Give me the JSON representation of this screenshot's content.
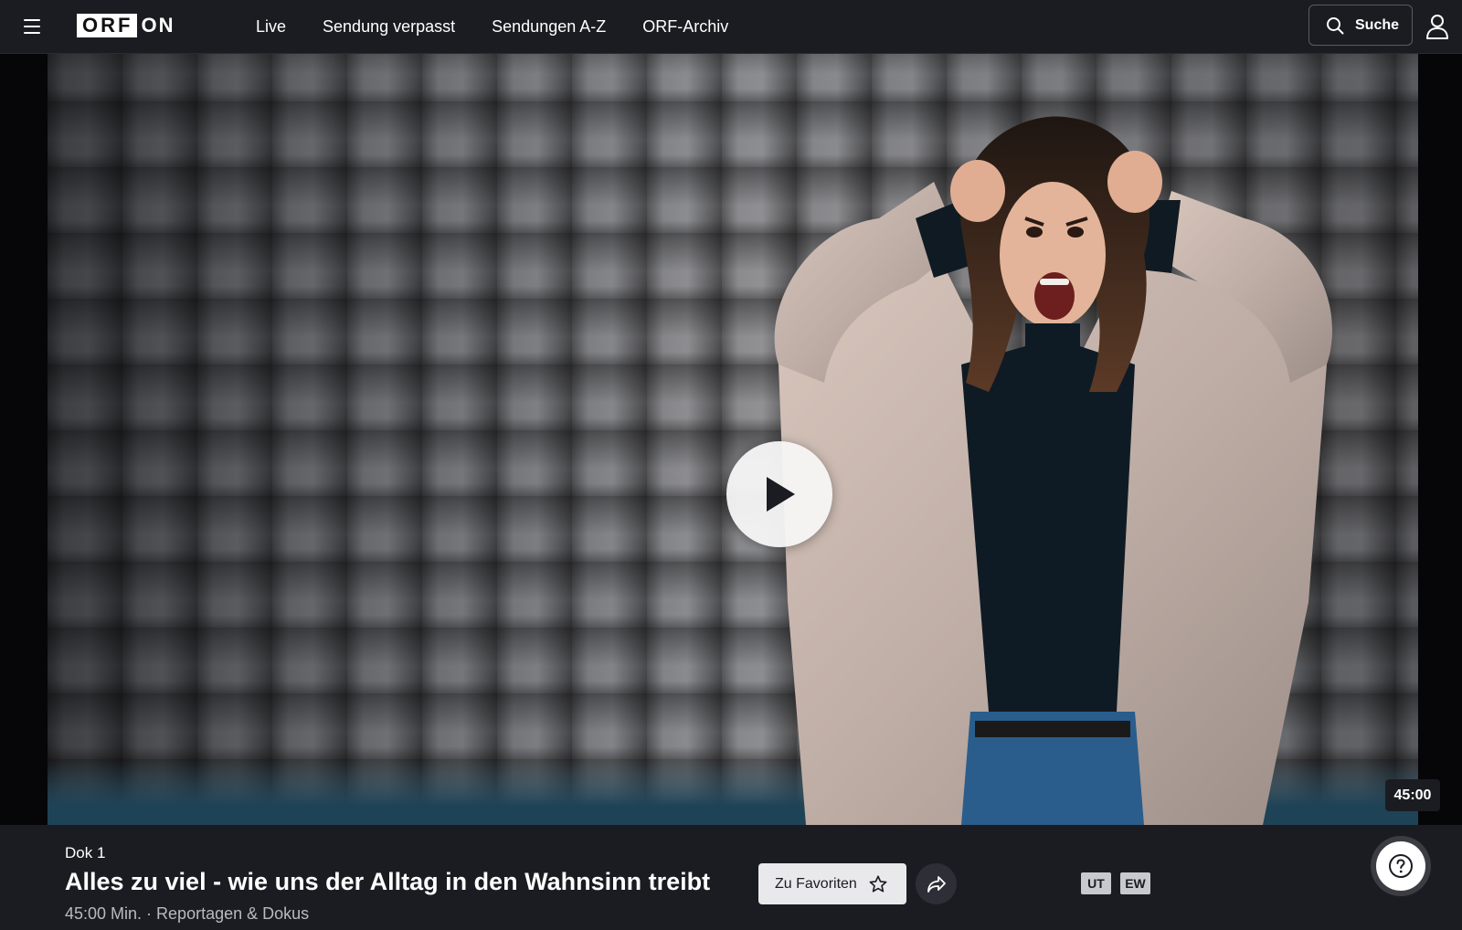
{
  "header": {
    "logo": {
      "box_text": "ORF",
      "suffix": "ON"
    },
    "nav": [
      {
        "label": "Live"
      },
      {
        "label": "Sendung verpasst"
      },
      {
        "label": "Sendungen A-Z"
      },
      {
        "label": "ORF-Archiv"
      }
    ],
    "search_label": "Suche",
    "icons": {
      "menu": "hamburger-menu-icon",
      "search": "search-icon",
      "user": "user-icon"
    }
  },
  "hero": {
    "duration": "45:00",
    "icons": {
      "play": "play-icon"
    }
  },
  "info": {
    "channel": "Dok 1",
    "title": "Alles zu viel - wie uns der Alltag in den Wahnsinn treibt",
    "meta": "45:00 Min. · Reportagen & Dokus",
    "favorites_label": "Zu Favoriten",
    "tags": [
      "UT",
      "EW"
    ],
    "icons": {
      "favorite": "star-icon",
      "share": "share-icon",
      "help": "help-icon"
    }
  },
  "colors": {
    "background": "#1b1c22",
    "button_light": "#e9e9ec",
    "tag_bg": "#c8c9cf"
  }
}
